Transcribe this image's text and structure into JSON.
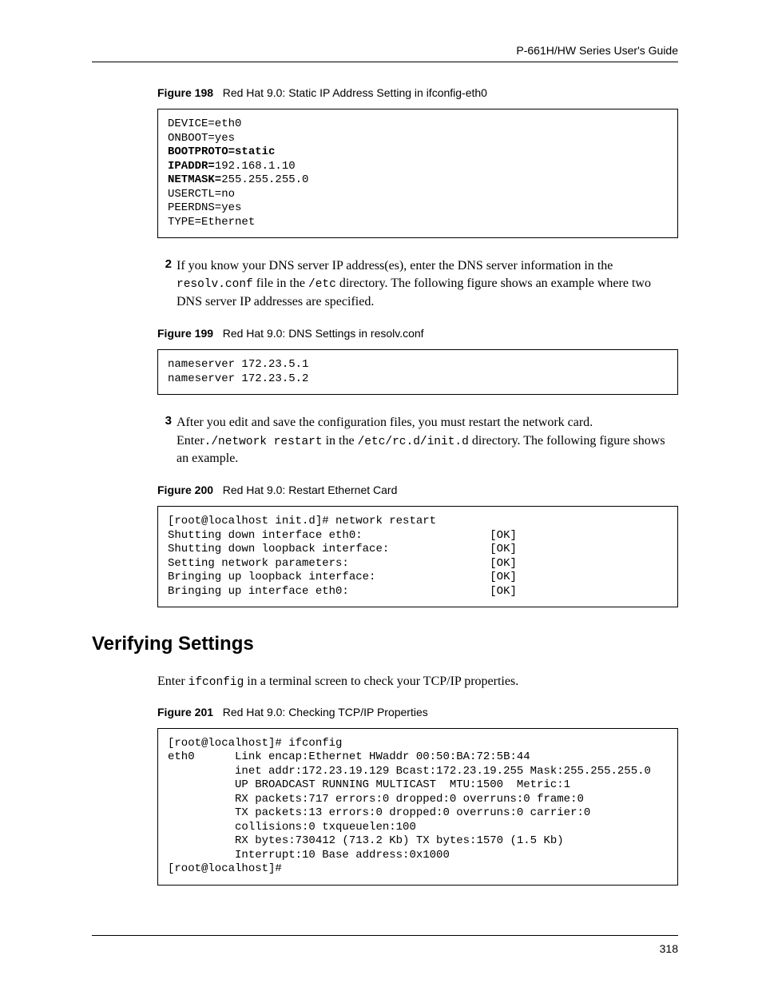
{
  "header": {
    "guide_title": "P-661H/HW Series User's Guide"
  },
  "fig198": {
    "label": "Figure 198",
    "caption": "Red Hat 9.0: Static IP Address Setting in ifconfig-eth0",
    "lines": {
      "l1": "DEVICE=eth0",
      "l2": "ONBOOT=yes",
      "l3": "BOOTPROTO=static",
      "l4a": "IPADDR=",
      "l4b": "192.168.1.10",
      "l5a": "NETMASK=",
      "l5b": "255.255.255.0",
      "l6": "USERCTL=no",
      "l7": "PEERDNS=yes",
      "l8": "TYPE=Ethernet"
    }
  },
  "step2": {
    "num": "2",
    "t1": "If you know your DNS server IP address(es), enter the DNS server information in the ",
    "c1": "resolv.conf",
    "t2": " file in the ",
    "c2": "/etc",
    "t3": " directory. The following figure shows an example where two DNS server IP addresses are specified."
  },
  "fig199": {
    "label": "Figure 199",
    "caption": "Red Hat 9.0: DNS Settings in resolv.conf",
    "content": "nameserver 172.23.5.1\nnameserver 172.23.5.2"
  },
  "step3": {
    "num": "3",
    "t1": "After you edit and save the configuration files, you must restart the network card. Enter",
    "c1": "./network restart",
    "t2": " in the ",
    "c2": "/etc/rc.d/init.d",
    "t3": " directory. The following figure shows an example."
  },
  "fig200": {
    "label": "Figure 200",
    "caption": "Red Hat 9.0: Restart Ethernet Card",
    "content": "[root@localhost init.d]# network restart\nShutting down interface eth0:                   [OK]\nShutting down loopback interface:               [OK]\nSetting network parameters:                     [OK]\nBringing up loopback interface:                 [OK]\nBringing up interface eth0:                     [OK]"
  },
  "section": {
    "title": "Verifying Settings",
    "p1a": "Enter ",
    "p1c": "ifconfig",
    "p1b": " in a terminal screen to check your TCP/IP properties."
  },
  "fig201": {
    "label": "Figure 201",
    "caption": "Red Hat 9.0: Checking TCP/IP Properties",
    "content": "[root@localhost]# ifconfig\neth0      Link encap:Ethernet HWaddr 00:50:BA:72:5B:44\n          inet addr:172.23.19.129 Bcast:172.23.19.255 Mask:255.255.255.0\n          UP BROADCAST RUNNING MULTICAST  MTU:1500  Metric:1\n          RX packets:717 errors:0 dropped:0 overruns:0 frame:0\n          TX packets:13 errors:0 dropped:0 overruns:0 carrier:0\n          collisions:0 txqueuelen:100\n          RX bytes:730412 (713.2 Kb) TX bytes:1570 (1.5 Kb)\n          Interrupt:10 Base address:0x1000\n[root@localhost]#"
  },
  "footer": {
    "page": "318"
  }
}
